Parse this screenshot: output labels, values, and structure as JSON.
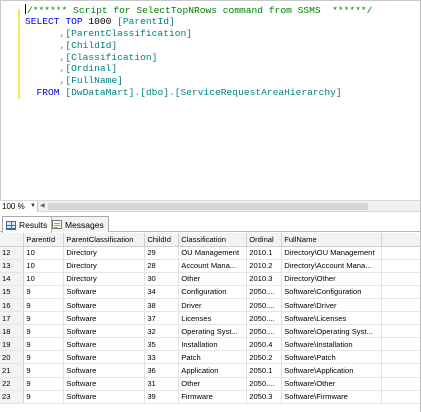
{
  "editor": {
    "lines": [
      [
        {
          "t": "/****** Script for SelectTopNRows command from SSMS  ******/",
          "c": "cm"
        }
      ],
      [
        {
          "t": "SELECT",
          "c": "kw"
        },
        {
          "t": " ",
          "c": ""
        },
        {
          "t": "TOP",
          "c": "kw"
        },
        {
          "t": " 1000 ",
          "c": ""
        },
        {
          "t": "[ParentId]",
          "c": "id"
        }
      ],
      [
        {
          "t": "      ,",
          "c": "op"
        },
        {
          "t": "[ParentClassification]",
          "c": "id"
        }
      ],
      [
        {
          "t": "      ,",
          "c": "op"
        },
        {
          "t": "[ChildId]",
          "c": "id"
        }
      ],
      [
        {
          "t": "      ,",
          "c": "op"
        },
        {
          "t": "[Classification]",
          "c": "id"
        }
      ],
      [
        {
          "t": "      ,",
          "c": "op"
        },
        {
          "t": "[Ordinal]",
          "c": "id"
        }
      ],
      [
        {
          "t": "      ,",
          "c": "op"
        },
        {
          "t": "[FullName]",
          "c": "id"
        }
      ],
      [
        {
          "t": "  FROM ",
          "c": "kw"
        },
        {
          "t": "[DwDataMart]",
          "c": "id"
        },
        {
          "t": ".",
          "c": "op"
        },
        {
          "t": "[dbo]",
          "c": "id"
        },
        {
          "t": ".",
          "c": "op"
        },
        {
          "t": "[ServiceRequestAreaHierarchy]",
          "c": "id"
        }
      ]
    ]
  },
  "zoom": {
    "value": "100 %"
  },
  "tabs": {
    "results": "Results",
    "messages": "Messages"
  },
  "grid": {
    "columns": [
      "",
      "ParentId",
      "ParentClassification",
      "ChildId",
      "Classification",
      "Ordinal",
      "FullName",
      ""
    ],
    "rows": [
      [
        "12",
        "10",
        "Directory",
        "29",
        "OU Management",
        "2010.1",
        "Directory\\OU Management",
        ""
      ],
      [
        "13",
        "10",
        "Directory",
        "28",
        "Account Mana...",
        "2010.2",
        "Directory\\Account Mana...",
        ""
      ],
      [
        "14",
        "10",
        "Directory",
        "30",
        "Other",
        "2010.3",
        "Directory\\Other",
        ""
      ],
      [
        "15",
        "9",
        "Software",
        "34",
        "Configuration",
        "2050....",
        "Software\\Configuration",
        ""
      ],
      [
        "16",
        "9",
        "Software",
        "38",
        "Driver",
        "2050....",
        "Software\\Driver",
        ""
      ],
      [
        "17",
        "9",
        "Software",
        "37",
        "Licenses",
        "2050....",
        "Software\\Licenses",
        ""
      ],
      [
        "18",
        "9",
        "Software",
        "32",
        "Operating Syst...",
        "2050....",
        "Software\\Operating Syst...",
        ""
      ],
      [
        "19",
        "9",
        "Software",
        "35",
        "Installation",
        "2050.4",
        "Software\\Installation",
        ""
      ],
      [
        "20",
        "9",
        "Software",
        "33",
        "Patch",
        "2050.2",
        "Software\\Patch",
        ""
      ],
      [
        "21",
        "9",
        "Software",
        "36",
        "Application",
        "2050.1",
        "Software\\Application",
        ""
      ],
      [
        "22",
        "9",
        "Software",
        "31",
        "Other",
        "2050....",
        "Software\\Other",
        ""
      ],
      [
        "23",
        "9",
        "Software",
        "39",
        "Firmware",
        "2050.3",
        "Software\\Firmware",
        ""
      ]
    ]
  }
}
